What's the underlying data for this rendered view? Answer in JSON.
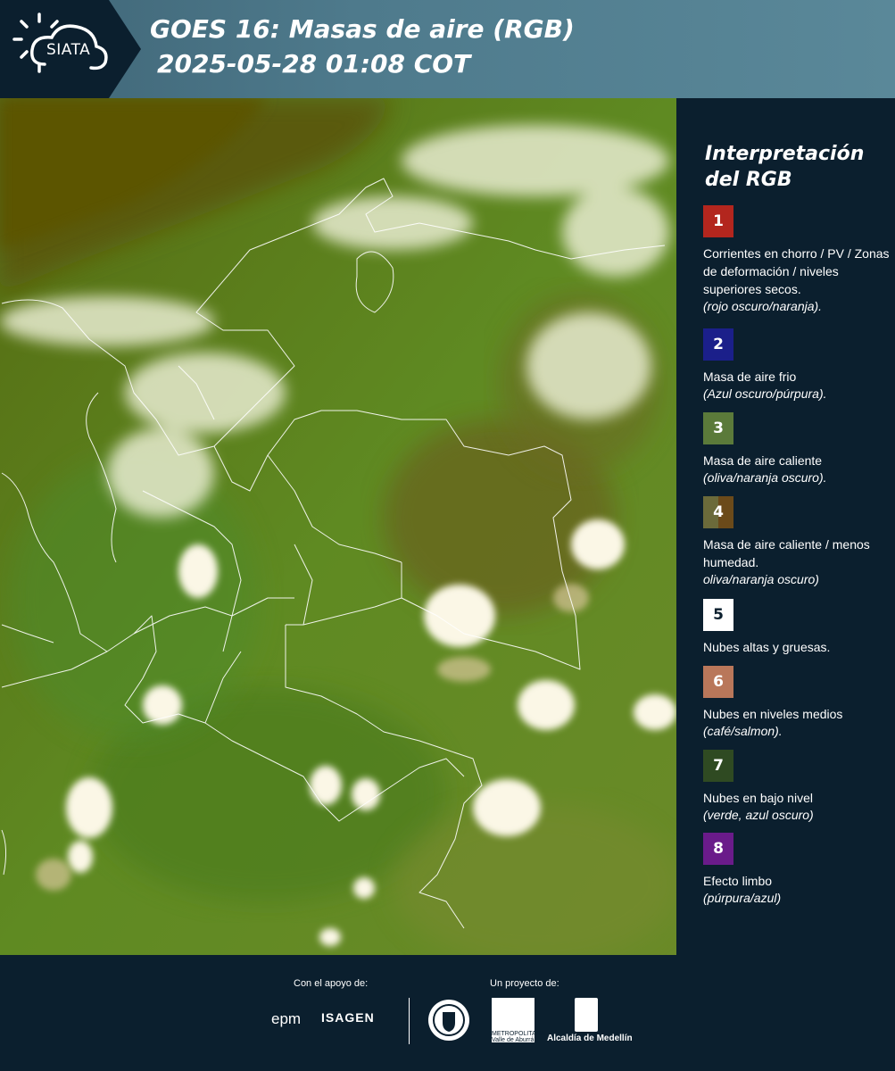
{
  "header": {
    "logo_text": "SIATA",
    "title_line1": "GOES 16: Masas de aire (RGB)",
    "title_line2": "2025-05-28 01:08 COT"
  },
  "legend": {
    "title_line1": "Interpretación",
    "title_line2": "del RGB",
    "items": [
      {
        "number": "1",
        "color": "#b3261e",
        "label": "Corrientes en chorro / PV / Zonas de deformación / niveles superiores secos.",
        "sub": "(rojo oscuro/naranja)."
      },
      {
        "number": "2",
        "color": "#1b1f8a",
        "label": "Masa de aire frio",
        "sub": "(Azul oscuro/púrpura)."
      },
      {
        "number": "3",
        "color": "#5b7a3a",
        "label": "Masa de aire caliente",
        "sub": "(oliva/naranja oscuro)."
      },
      {
        "number": "4",
        "color": "#6b5a2a",
        "label": "Masa de aire caliente / menos humedad.",
        "sub": "oliva/naranja oscuro)"
      },
      {
        "number": "5",
        "color": "#ffffff",
        "label": "Nubes altas y gruesas.",
        "sub": ""
      },
      {
        "number": "6",
        "color": "#b9775a",
        "label": "Nubes en niveles medios",
        "sub": "(café/salmon)."
      },
      {
        "number": "7",
        "color": "#2f4a22",
        "label": "Nubes en bajo nivel",
        "sub": "(verde, azul oscuro)"
      },
      {
        "number": "8",
        "color": "#6a1b8a",
        "label": "Efecto limbo",
        "sub": "(púrpura/azul)"
      }
    ]
  },
  "footer": {
    "support_label": "Con el apoyo de:",
    "project_label": "Un proyecto de:",
    "sponsor1": "epm",
    "sponsor2": "ISAGEN",
    "partner1_text": "METROPOLITANA Valle de Aburrá",
    "partner2": "Alcaldía de Medellín"
  }
}
